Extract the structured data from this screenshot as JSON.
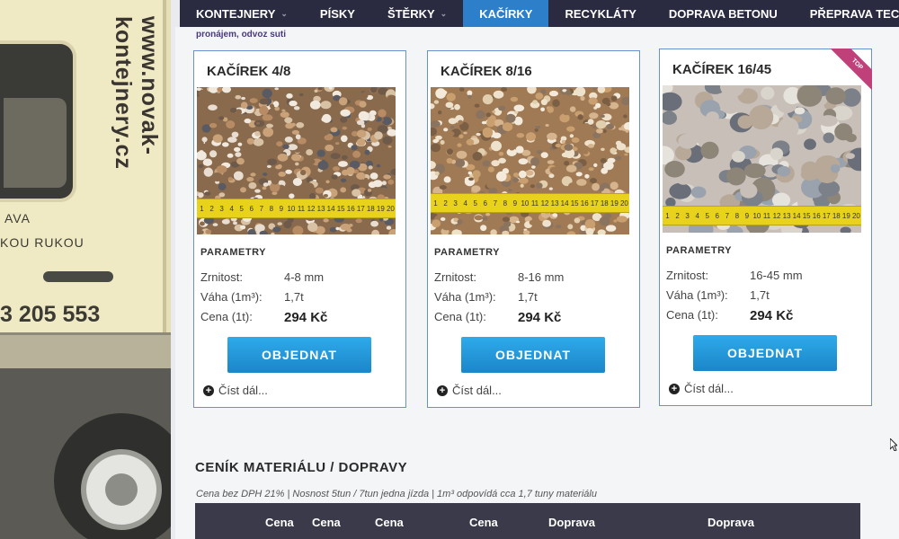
{
  "truck": {
    "url": "www.novak-kontejnery.cz",
    "text1": "AVA",
    "text2": "KOU RUKOU",
    "phone": "3 205 553"
  },
  "nav": {
    "items": [
      {
        "label": "Kontejnery",
        "has_caret": true
      },
      {
        "label": "Písky",
        "has_caret": false
      },
      {
        "label": "Štěrky",
        "has_caret": true
      },
      {
        "label": "Kačírky",
        "has_caret": false,
        "active": true
      },
      {
        "label": "Recykláty",
        "has_caret": false
      },
      {
        "label": "Doprava betonu",
        "has_caret": false
      },
      {
        "label": "Přeprava technik",
        "has_caret": false
      }
    ]
  },
  "subline": "pronájem, odvoz suti",
  "params_label": "PARAMETRY",
  "labels": {
    "grain": "Zrnitost:",
    "weight": "Váha (1m³):",
    "price": "Cena (1t):",
    "order": "OBJEDNAT",
    "more": "Číst dál..."
  },
  "products": [
    {
      "title": "KAČÍREK 4/8",
      "grain": "4-8 mm",
      "weight": "1,7t",
      "price": "294 Kč",
      "top": false
    },
    {
      "title": "KAČÍREK 8/16",
      "grain": "8-16 mm",
      "weight": "1,7t",
      "price": "294 Kč",
      "top": false
    },
    {
      "title": "KAČÍREK 16/45",
      "grain": "16-45 mm",
      "weight": "1,7t",
      "price": "294 Kč",
      "top": true,
      "badge": "TOP"
    }
  ],
  "pricing": {
    "title": "CENÍK MATERIÁLU / DOPRAVY",
    "note": "Cena bez DPH 21% | Nosnost 5tun / 7tun jedna jízda | 1m³ odpovídá cca 1,7 tuny materiálu",
    "headers": [
      "Cena",
      "Cena",
      "Cena",
      "Cena",
      "Doprava",
      "Doprava"
    ]
  },
  "colors": {
    "nav_bg": "#2a2a40",
    "nav_active": "#2e7fc9",
    "button": "#1f95d8",
    "badge": "#c0407a"
  }
}
